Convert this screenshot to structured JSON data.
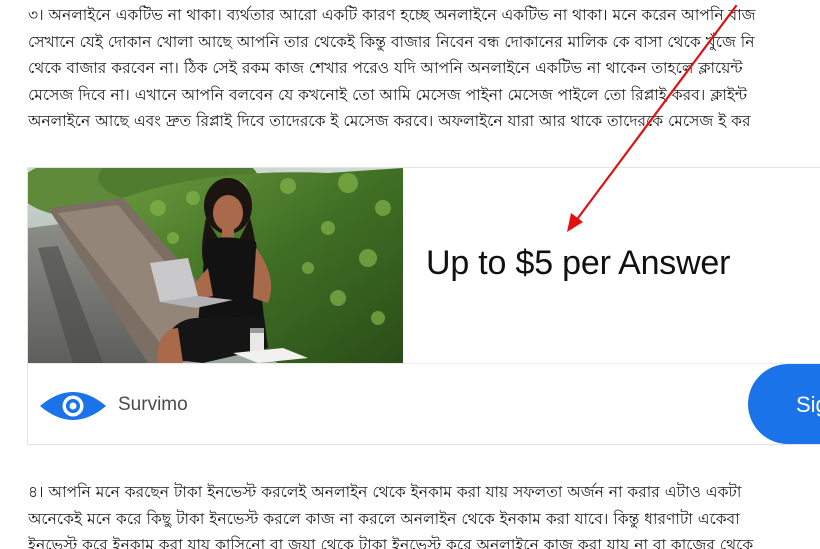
{
  "article": {
    "paragraph_top": [
      "৩। অনলাইনে একটিভ না থাকা। ব্যর্থতার আরো একটি কারণ হচ্ছে অনলাইনে একটিভ না থাকা। মনে করেন আপনি বাজ",
      "সেখানে যেই দোকান খোলা আছে আপনি তার থেকেই কিন্তু বাজার নিবেন বন্ধ দোকানের মালিক কে বাসা থেকে খুঁজে নি",
      "থেকে বাজার করবেন না। ঠিক সেই রকম কাজ শেখার পরেও যদি আপনি অনলাইনে একটিভ না থাকেন তাহলে ক্লায়েন্ট",
      "মেসেজ দিবে না। এখানে আপনি বলবেন যে কখনোই তো আমি মেসেজ পাইনা মেসেজ পাইলে তো রিপ্লাই করব। ক্লাইন্ট",
      "অনলাইনে আছে এবং দ্রুত রিপ্লাই দিবে তাদেরকে ই মেসেজ করবে। অফলাইনে যারা আর থাকে তাদেরকে মেসেজ ই কর"
    ],
    "paragraph_bottom": [
      "৪। আপনি মনে করছেন টাকা ইনভেস্ট করলেই অনলাইন থেকে ইনকাম করা যায় সফলতা অর্জন না করার এটাও একটা",
      "অনেকেই মনে করে কিছু টাকা ইনভেস্ট করলে কাজ না করলে অনলাইন থেকে ইনকাম করা যাবে। কিন্তু ধারণাটা একেবা",
      "ইনভেস্ট করে ইনকাম করা যায় কাসিনো বা জুয়া থেকে টাকা ইনভেস্ট করে অনলাইনে কাজ করা যায় না বা কাজের থেকে"
    ]
  },
  "ad": {
    "headline": "Up to $5 per Answer",
    "brand_name": "Survimo",
    "cta_label": "Sig",
    "brand_color": "#1a73e8",
    "annotation_color": "#e01010"
  }
}
